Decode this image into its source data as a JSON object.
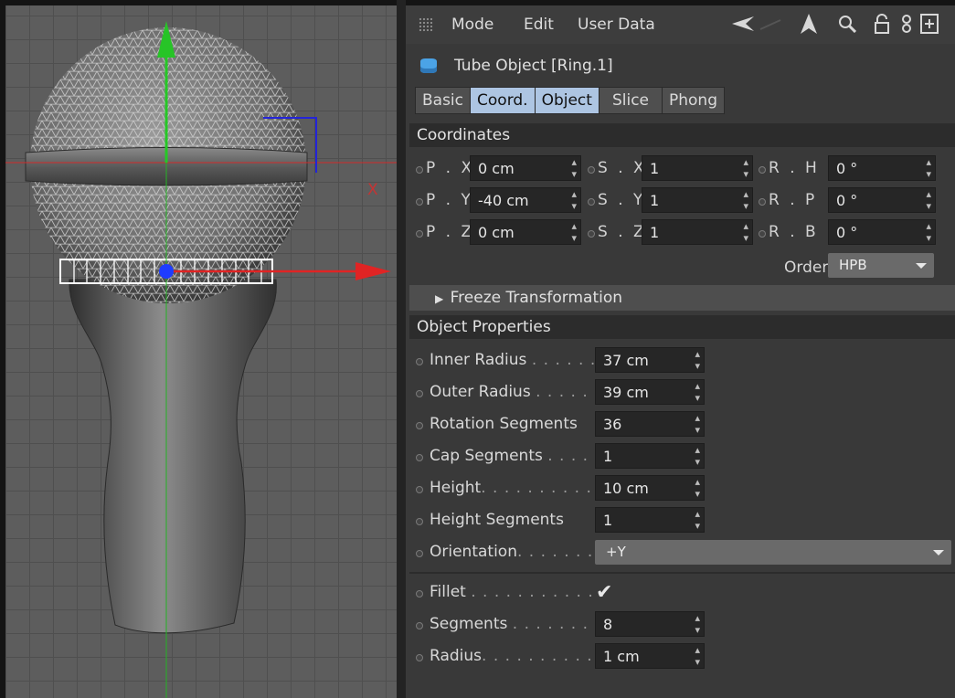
{
  "viewport": {
    "axis_label": "X"
  },
  "menubar": {
    "items": [
      "Mode",
      "Edit",
      "User Data"
    ],
    "icons": [
      "back-arrow-icon",
      "forward-arrow-icon",
      "up-arrow-icon",
      "search-icon",
      "lock-icon",
      "link-icon",
      "add-icon"
    ]
  },
  "object": {
    "title": "Tube Object [Ring.1]",
    "icon": "tube-object-icon"
  },
  "tabs": [
    {
      "label": "Basic",
      "active": false
    },
    {
      "label": "Coord.",
      "active": true
    },
    {
      "label": "Object",
      "active": true
    },
    {
      "label": "Slice",
      "active": false
    },
    {
      "label": "Phong",
      "active": false
    }
  ],
  "coordinates": {
    "header": "Coordinates",
    "rows": [
      {
        "p_label": "P . X",
        "p_value": "0 cm",
        "s_label": "S . X",
        "s_value": "1",
        "r_label": "R . H",
        "r_value": "0 °"
      },
      {
        "p_label": "P . Y",
        "p_value": "-40 cm",
        "s_label": "S . Y",
        "s_value": "1",
        "r_label": "R . P",
        "r_value": "0 °"
      },
      {
        "p_label": "P . Z",
        "p_value": "0 cm",
        "s_label": "S . Z",
        "s_value": "1",
        "r_label": "R . B",
        "r_value": "0 °"
      }
    ],
    "order_label": "Order",
    "order_value": "HPB",
    "freeze_label": "Freeze Transformation"
  },
  "object_properties": {
    "header": "Object Properties",
    "inner_radius": {
      "label": "Inner Radius",
      "leader": ". . . . . .",
      "value": "37 cm"
    },
    "outer_radius": {
      "label": "Outer Radius",
      "leader": ". . . . .",
      "value": "39 cm"
    },
    "rotation_segments": {
      "label": "Rotation Segments",
      "leader": "",
      "value": "36"
    },
    "cap_segments": {
      "label": "Cap Segments",
      "leader": ". . . .",
      "value": "1"
    },
    "height": {
      "label": "Height",
      "leader": ". . . . . . . . . . .",
      "value": "10 cm"
    },
    "height_segments": {
      "label": "Height Segments",
      "leader": "",
      "value": "1"
    },
    "orientation": {
      "label": "Orientation",
      "leader": ". . . . . . .",
      "value": "+Y"
    },
    "fillet": {
      "label": "Fillet",
      "leader": ". . . . . . . . . . . .",
      "checked": true,
      "check_glyph": "✔"
    },
    "segments": {
      "label": "Segments",
      "leader": ". . . . . . . .",
      "value": "8"
    },
    "radius": {
      "label": "Radius",
      "leader": ". . . . . . . . . . .",
      "value": "1 cm"
    }
  },
  "colors": {
    "active_tab": "#adc5e2",
    "field_bg": "#262626",
    "section_bg": "#2c2c2c",
    "axis_y": "#27c427",
    "axis_x": "#e02424",
    "axis_z": "#2424d8",
    "selection": "#1e3cff"
  }
}
